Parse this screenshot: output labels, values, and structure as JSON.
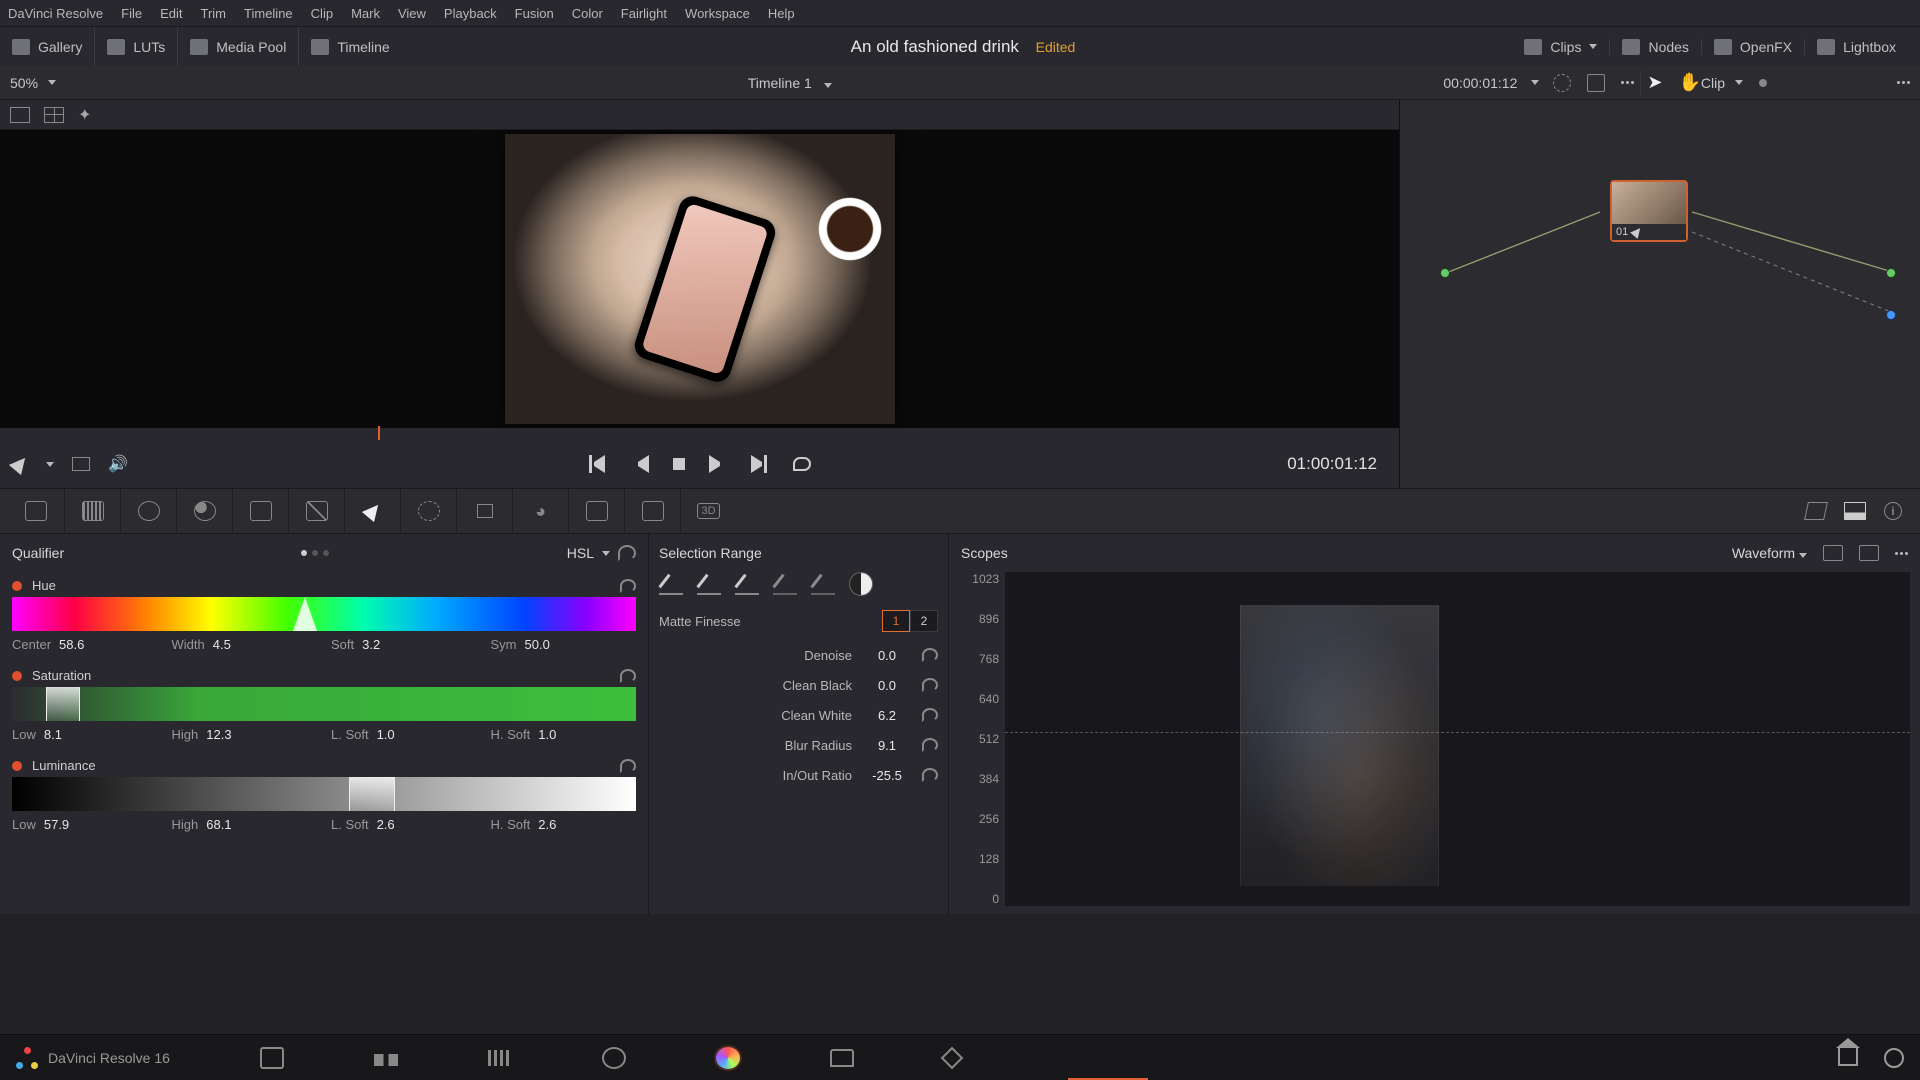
{
  "menu": [
    "DaVinci Resolve",
    "File",
    "Edit",
    "Trim",
    "Timeline",
    "Clip",
    "Mark",
    "View",
    "Playback",
    "Fusion",
    "Color",
    "Fairlight",
    "Workspace",
    "Help"
  ],
  "toolbar": {
    "gallery": "Gallery",
    "luts": "LUTs",
    "mediapool": "Media Pool",
    "timeline": "Timeline",
    "clips": "Clips",
    "nodes": "Nodes",
    "openfx": "OpenFX",
    "lightbox": "Lightbox"
  },
  "project": {
    "title": "An old fashioned drink",
    "status": "Edited"
  },
  "sub": {
    "zoom": "50%",
    "timeline": "Timeline 1",
    "tc": "00:00:01:12",
    "nodezoom": "Clip"
  },
  "transport": {
    "tc": "01:00:01:12"
  },
  "node": {
    "label": "01"
  },
  "qualifier": {
    "title": "Qualifier",
    "mode": "HSL",
    "hue": {
      "label": "Hue",
      "center_l": "Center",
      "center": "58.6",
      "width_l": "Width",
      "width": "4.5",
      "soft_l": "Soft",
      "soft": "3.2",
      "sym_l": "Sym",
      "sym": "50.0"
    },
    "sat": {
      "label": "Saturation",
      "low_l": "Low",
      "low": "8.1",
      "high_l": "High",
      "high": "12.3",
      "lsoft_l": "L. Soft",
      "lsoft": "1.0",
      "hsoft_l": "H. Soft",
      "hsoft": "1.0"
    },
    "lum": {
      "label": "Luminance",
      "low_l": "Low",
      "low": "57.9",
      "high_l": "High",
      "high": "68.1",
      "lsoft_l": "L. Soft",
      "lsoft": "2.6",
      "hsoft_l": "H. Soft",
      "hsoft": "2.6"
    }
  },
  "selection": {
    "title": "Selection Range",
    "matte": "Matte Finesse",
    "tab1": "1",
    "tab2": "2",
    "rows": {
      "denoise_l": "Denoise",
      "denoise": "0.0",
      "cblack_l": "Clean Black",
      "cblack": "0.0",
      "cwhite_l": "Clean White",
      "cwhite": "6.2",
      "blur_l": "Blur Radius",
      "blur": "9.1",
      "ratio_l": "In/Out Ratio",
      "ratio": "-25.5"
    }
  },
  "scopes": {
    "title": "Scopes",
    "mode": "Waveform",
    "ticks": [
      "1023",
      "896",
      "768",
      "640",
      "512",
      "384",
      "256",
      "128",
      "0"
    ]
  },
  "footer": {
    "app": "DaVinci Resolve 16"
  }
}
